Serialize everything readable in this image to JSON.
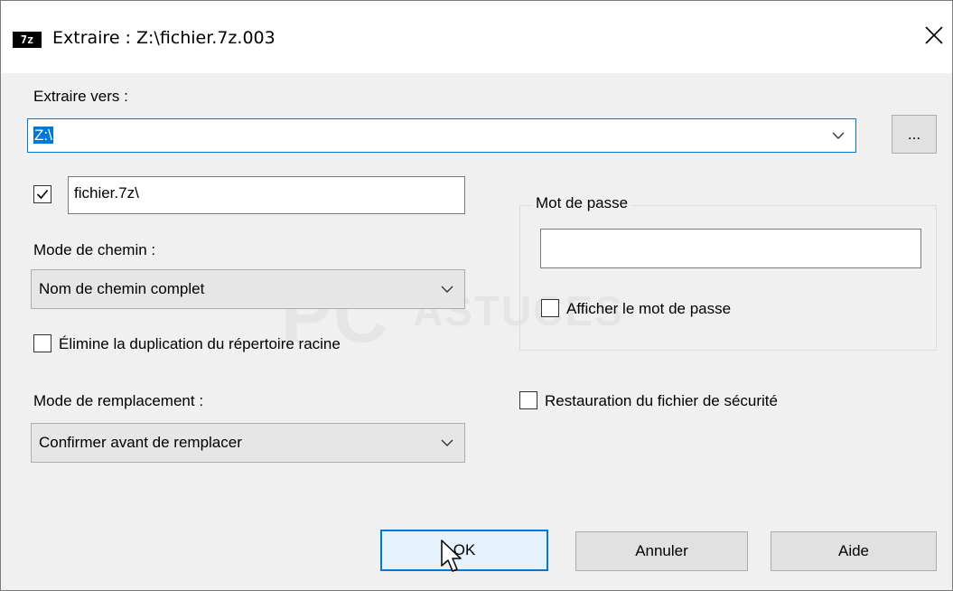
{
  "window": {
    "title": "Extraire : Z:\\fichier.7z.003",
    "icon_text": "7z"
  },
  "extract_to": {
    "label": "Extraire vers :",
    "value": "Z:\\",
    "browse_label": "..."
  },
  "subfolder": {
    "checked": true,
    "value": "fichier.7z\\"
  },
  "path_mode": {
    "label": "Mode de chemin :",
    "value": "Nom de chemin complet"
  },
  "eliminate_dup": {
    "checked": false,
    "label": "Élimine la duplication du répertoire racine"
  },
  "overwrite_mode": {
    "label": "Mode de remplacement :",
    "value": "Confirmer avant de remplacer"
  },
  "password": {
    "group_label": "Mot de passe",
    "value": "",
    "show_label": "Afficher le mot de passe",
    "show_checked": false
  },
  "restore_security": {
    "checked": false,
    "label": "Restauration du fichier de sécurité"
  },
  "buttons": {
    "ok": "OK",
    "cancel": "Annuler",
    "help": "Aide"
  },
  "colors": {
    "accent": "#0078d7",
    "dialog_bg": "#f0f0f0"
  },
  "watermark": {
    "main": "PC",
    "sub": "ASTUCES"
  }
}
